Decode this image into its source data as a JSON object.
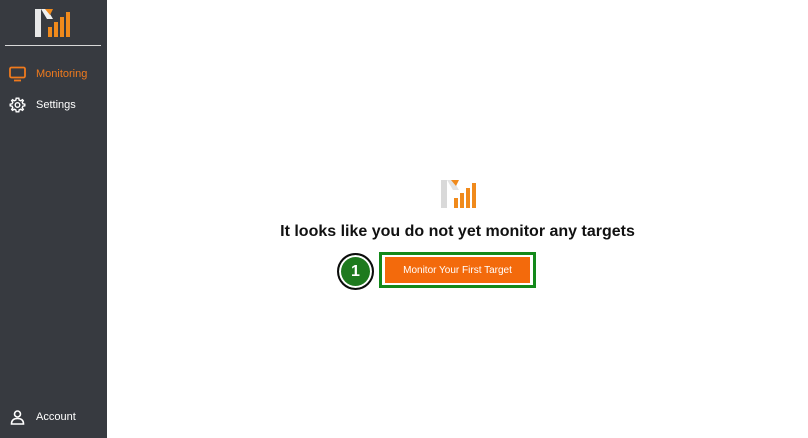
{
  "sidebar": {
    "logo_icon": "brand-logo-icon",
    "items": [
      {
        "label": "Monitoring",
        "icon": "monitor-icon",
        "active": true
      },
      {
        "label": "Settings",
        "icon": "gear-icon",
        "active": false
      }
    ],
    "account": {
      "label": "Account",
      "icon": "user-icon"
    }
  },
  "main": {
    "empty_state_icon": "brand-logo-icon",
    "empty_title": "It looks like you do not yet monitor any targets",
    "cta_label": "Monitor Your First Target",
    "step_number": "1"
  },
  "colors": {
    "sidebar_bg": "#373a40",
    "accent": "#f07a1d",
    "cta_bg": "#f36a0c",
    "highlight": "#13891a"
  }
}
